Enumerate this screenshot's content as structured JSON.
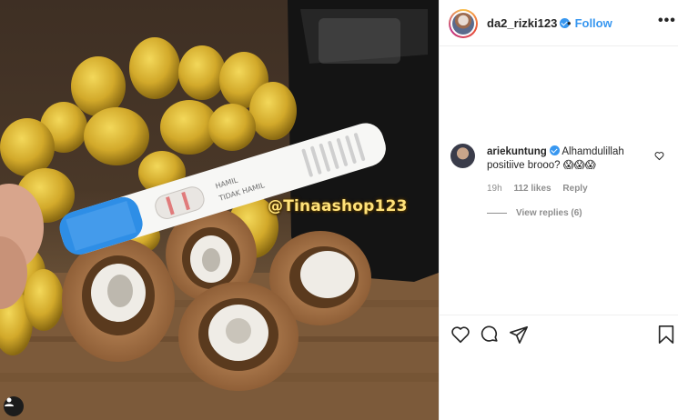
{
  "photo": {
    "watermark": "@Tinaashop123",
    "test_labels": {
      "hamil": "HAMIL",
      "tidak_hamil": "TIDAK HAMIL"
    }
  },
  "header": {
    "username": "da2_rizki123",
    "follow_label": "Follow",
    "more_label": "•••"
  },
  "comments": [
    {
      "username": "ariekuntung",
      "text": "Alhamdulillah positiive brooo? 😱😱😱",
      "time": "19h",
      "likes": "112 likes",
      "reply_label": "Reply",
      "view_replies": "View replies (6)"
    }
  ],
  "colors": {
    "accent": "#3897f0",
    "text": "#262626",
    "meta": "#8e8e8e",
    "watermark": "#ffe27a",
    "test_blue": "#2e8ee6"
  },
  "icons": [
    "heart-icon",
    "comment-icon",
    "share-icon",
    "bookmark-icon",
    "user-tag-icon",
    "verified-icon"
  ]
}
